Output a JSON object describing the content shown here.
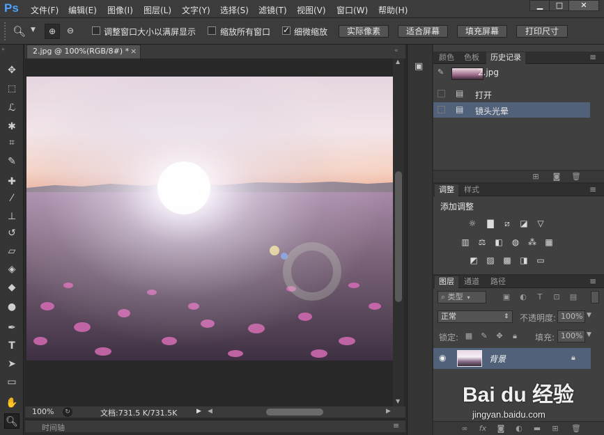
{
  "app": {
    "logo": "Ps"
  },
  "menu": [
    "文件(F)",
    "编辑(E)",
    "图像(I)",
    "图层(L)",
    "文字(Y)",
    "选择(S)",
    "滤镜(T)",
    "视图(V)",
    "窗口(W)",
    "帮助(H)"
  ],
  "window_buttons": [
    "▁",
    "□",
    "✕"
  ],
  "options": {
    "resize_windows_label": "调整窗口大小以满屏显示",
    "resize_windows_checked": false,
    "zoom_all_label": "缩放所有窗口",
    "zoom_all_checked": false,
    "scrubby_zoom_label": "细微缩放",
    "scrubby_zoom_checked": true,
    "actual_pixels": "实际像素",
    "fit_screen": "适合屏幕",
    "fill_screen": "填充屏幕",
    "print_size": "打印尺寸"
  },
  "document": {
    "tab_title": "2.jpg @ 100%(RGB/8#) *",
    "close": "×"
  },
  "status": {
    "zoom": "100%",
    "doc_info": "文档:731.5 K/731.5K"
  },
  "timeline": {
    "label": "时间轴"
  },
  "history_panel": {
    "tabs": [
      "颜色",
      "色板",
      "历史记录"
    ],
    "active_tab": "历史记录",
    "snapshot_name": "2.jpg",
    "states": [
      "打开",
      "镜头光晕"
    ],
    "selected_state": "镜头光晕"
  },
  "adjustments_panel": {
    "tabs": [
      "调整",
      "样式"
    ],
    "active_tab": "调整",
    "heading": "添加调整"
  },
  "layers_panel": {
    "tabs": [
      "图层",
      "通道",
      "路径"
    ],
    "active_tab": "图层",
    "filter_kind": "类型",
    "blend_mode": "正常",
    "opacity_label": "不透明度:",
    "opacity_value": "100%",
    "lock_label": "锁定:",
    "fill_label": "填充:",
    "fill_value": "100%",
    "layers": [
      {
        "name": "背景",
        "visible": true,
        "locked": true
      }
    ]
  },
  "watermark": {
    "brand": "Bai du 经验",
    "url": "jingyan.baidu.com"
  },
  "colors": {
    "accent": "#4da3ff",
    "selection": "#52617a",
    "ui_dark": "#2b2b2b"
  }
}
